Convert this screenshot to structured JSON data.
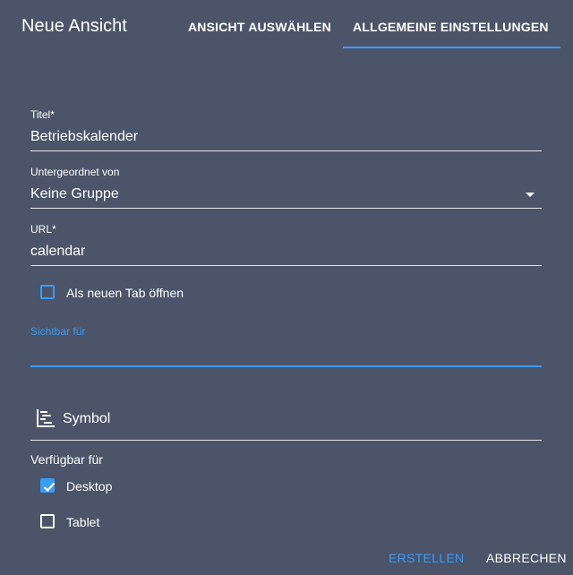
{
  "dialog": {
    "title": "Neue Ansicht",
    "tabs": [
      {
        "label": "ANSICHT AUSWÄHLEN"
      },
      {
        "label": "ALLGEMEINE EINSTELLUNGEN",
        "active": true
      }
    ]
  },
  "form": {
    "titel": {
      "label": "Titel*",
      "value": "Betriebskalender"
    },
    "parent": {
      "label": "Untergeordnet von",
      "value": "Keine Gruppe"
    },
    "url": {
      "label": "URL*",
      "value": "calendar"
    },
    "new_tab": {
      "label": "Als neuen Tab öffnen",
      "checked": false
    },
    "visible_for": {
      "label": "Sichtbar für",
      "value": ""
    },
    "symbol": {
      "label": "Symbol",
      "icon": "gantt-icon"
    },
    "available_for": {
      "label": "Verfügbar für",
      "options": [
        {
          "label": "Desktop",
          "checked": true
        },
        {
          "label": "Tablet",
          "checked": false
        }
      ]
    }
  },
  "actions": {
    "create": "ERSTELLEN",
    "cancel": "ABBRECHEN"
  },
  "colors": {
    "background": "#4b5469",
    "accent": "#3b9bf5",
    "text": "#ffffff"
  }
}
